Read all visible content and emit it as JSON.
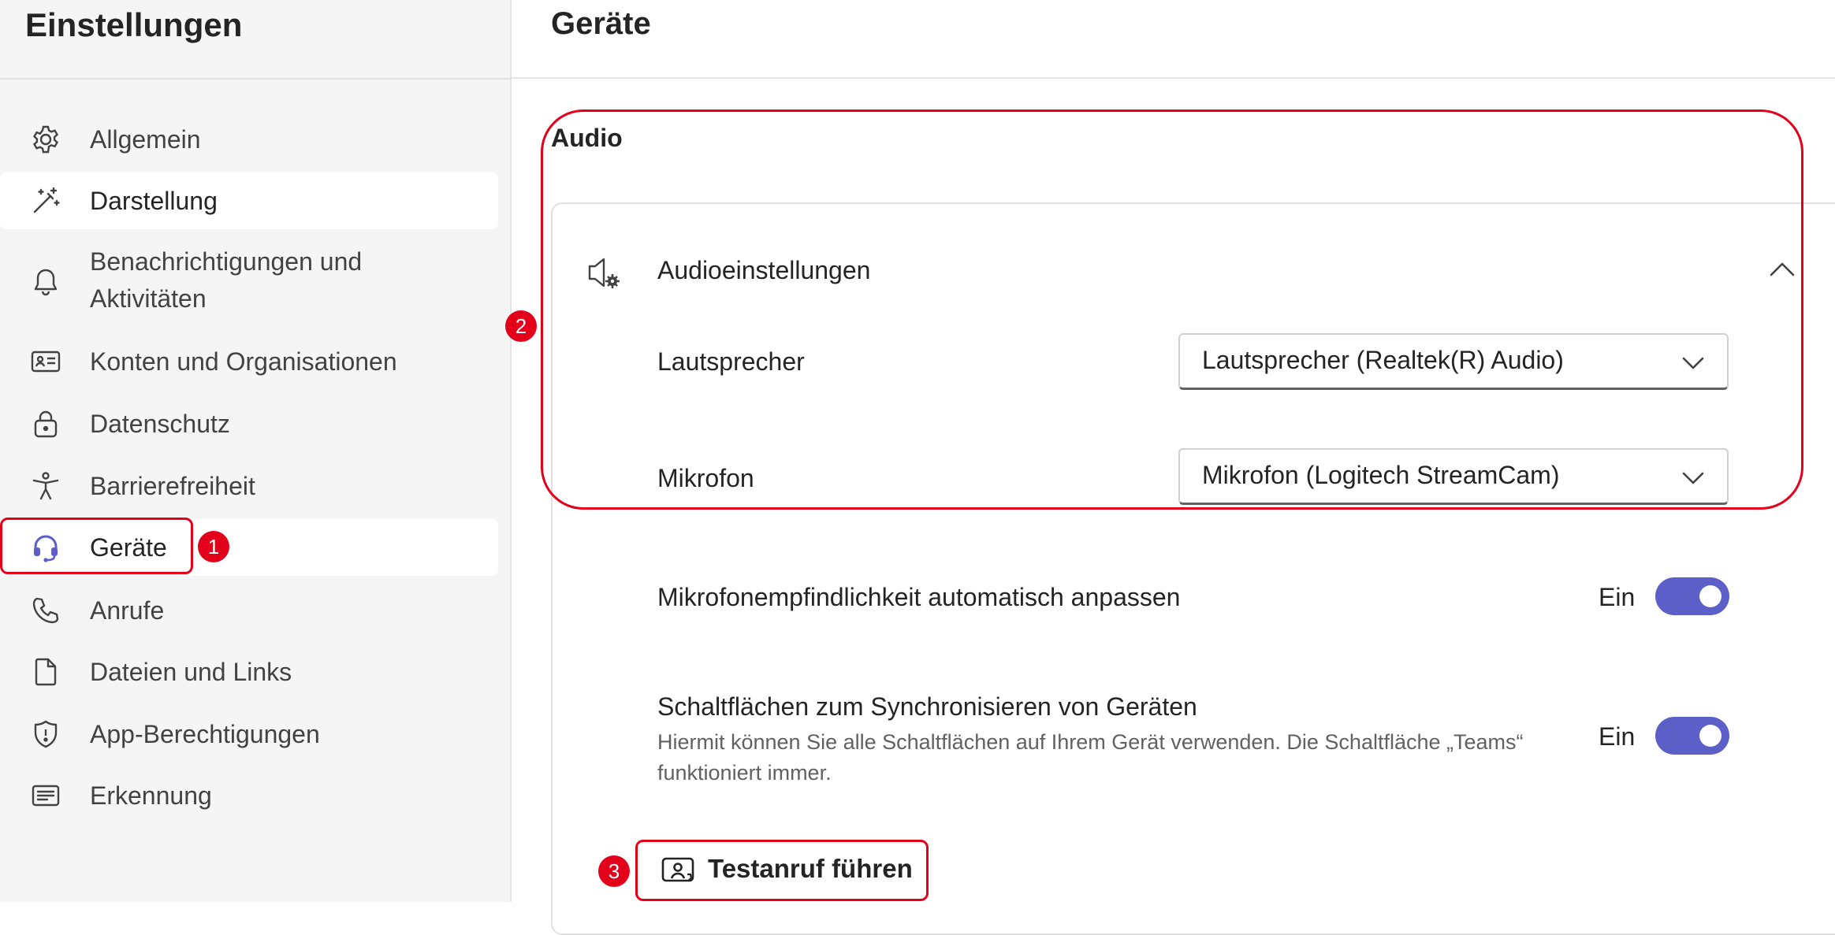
{
  "sidebar": {
    "title": "Einstellungen",
    "items": [
      {
        "label": "Allgemein",
        "icon": "gear-icon"
      },
      {
        "label": "Darstellung",
        "icon": "magic-wand-icon"
      },
      {
        "label_line1": "Benachrichtigungen und",
        "label_line2": "Aktivitäten",
        "icon": "bell-icon"
      },
      {
        "label": "Konten und Organisationen",
        "icon": "id-card-icon"
      },
      {
        "label": "Datenschutz",
        "icon": "lock-icon"
      },
      {
        "label": "Barrierefreiheit",
        "icon": "accessibility-icon"
      },
      {
        "label": "Geräte",
        "icon": "headset-icon"
      },
      {
        "label": "Anrufe",
        "icon": "phone-icon"
      },
      {
        "label": "Dateien und Links",
        "icon": "document-icon"
      },
      {
        "label": "App-Berechtigungen",
        "icon": "shield-icon"
      },
      {
        "label": "Erkennung",
        "icon": "text-box-icon"
      }
    ]
  },
  "header": {
    "title": "Geräte"
  },
  "audio": {
    "section_title": "Audio",
    "card_title": "Audioeinstellungen",
    "speaker": {
      "label": "Lautsprecher",
      "value": "Lautsprecher (Realtek(R) Audio)"
    },
    "microphone": {
      "label": "Mikrofon",
      "value": "Mikrofon (Logitech StreamCam)"
    },
    "auto_gain": {
      "label": "Mikrofonempfindlichkeit automatisch anpassen",
      "state": "Ein"
    },
    "sync_buttons": {
      "label": "Schaltflächen zum Synchronisieren von Geräten",
      "description": "Hiermit können Sie alle Schaltflächen auf Ihrem Gerät verwenden. Die Schaltfläche „Teams“ funktioniert immer.",
      "state": "Ein"
    },
    "test_call": {
      "label": "Testanruf führen"
    }
  },
  "annotations": {
    "badge_1": "1",
    "badge_2": "2",
    "badge_3": "3",
    "color": "#e3001b"
  },
  "colors": {
    "accent": "#5b5fc7",
    "sidebar_bg": "#f5f5f5"
  }
}
